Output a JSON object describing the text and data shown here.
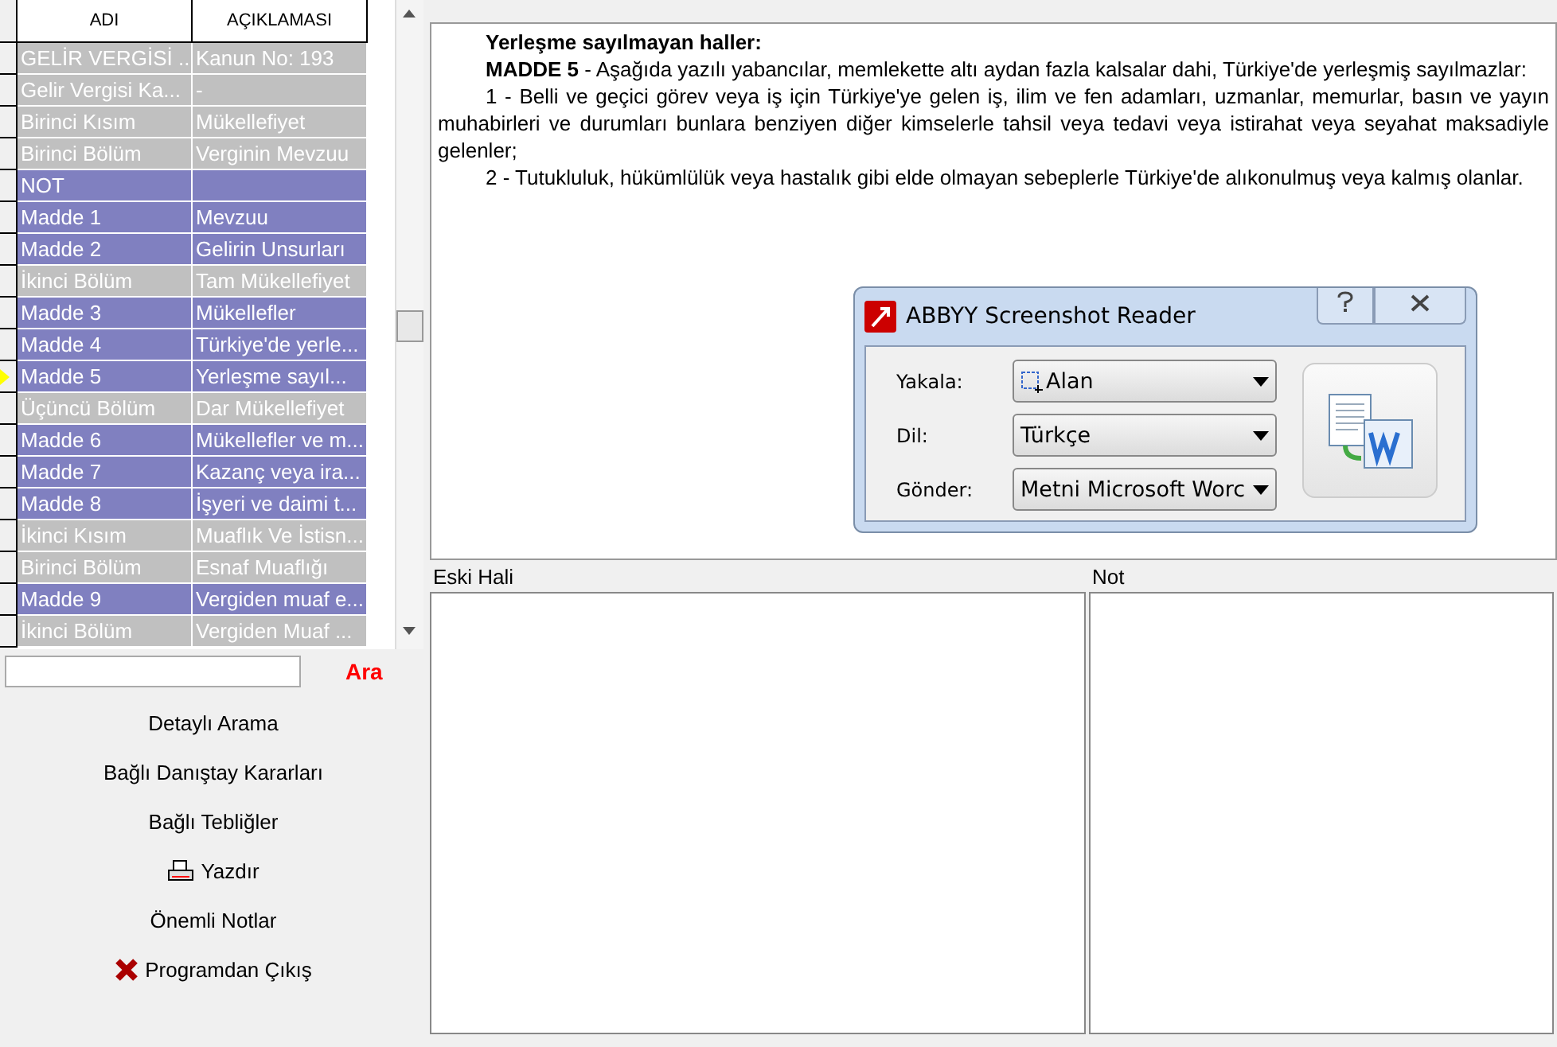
{
  "grid": {
    "columns": [
      "ADI",
      "AÇIKLAMASI"
    ],
    "rows": [
      {
        "name": "GELİR VERGİSİ ...",
        "desc": "Kanun No: 193",
        "kind": "section",
        "current": false
      },
      {
        "name": "Gelir Vergisi Ka...",
        "desc": "-",
        "kind": "section",
        "current": false
      },
      {
        "name": "Birinci Kısım",
        "desc": "Mükellefiyet",
        "kind": "section",
        "current": false
      },
      {
        "name": "Birinci Bölüm",
        "desc": "Verginin Mevzuu",
        "kind": "section",
        "current": false
      },
      {
        "name": "NOT",
        "desc": "",
        "kind": "article",
        "current": false
      },
      {
        "name": "Madde 1",
        "desc": "Mevzuu",
        "kind": "article",
        "current": false
      },
      {
        "name": "Madde 2",
        "desc": "Gelirin Unsurları",
        "kind": "article",
        "current": false
      },
      {
        "name": "İkinci Bölüm",
        "desc": "Tam Mükellefiyet",
        "kind": "section",
        "current": false
      },
      {
        "name": "Madde 3",
        "desc": "Mükellefler",
        "kind": "article",
        "current": false
      },
      {
        "name": "Madde 4",
        "desc": "Türkiye'de yerle...",
        "kind": "article",
        "current": false
      },
      {
        "name": "Madde 5",
        "desc": "Yerleşme sayıl...",
        "kind": "article",
        "current": true
      },
      {
        "name": "Üçüncü Bölüm",
        "desc": "Dar Mükellefiyet",
        "kind": "section",
        "current": false
      },
      {
        "name": "Madde 6",
        "desc": "Mükellefler ve m...",
        "kind": "article",
        "current": false
      },
      {
        "name": "Madde 7",
        "desc": "Kazanç veya ira...",
        "kind": "article",
        "current": false
      },
      {
        "name": "Madde 8",
        "desc": "İşyeri ve daimi t...",
        "kind": "article",
        "current": false
      },
      {
        "name": "İkinci Kısım",
        "desc": "Muaflık Ve İstisn...",
        "kind": "section",
        "current": false
      },
      {
        "name": "Birinci Bölüm",
        "desc": "Esnaf Muaflığı",
        "kind": "section",
        "current": false
      },
      {
        "name": "Madde 9",
        "desc": "Vergiden muaf e...",
        "kind": "article",
        "current": false
      },
      {
        "name": "İkinci Bölüm",
        "desc": "Vergiden Muaf ...",
        "kind": "section",
        "current": false
      }
    ]
  },
  "search": {
    "button": "Ara"
  },
  "menu": [
    {
      "label": "Detaylı Arama"
    },
    {
      "label": "Bağlı Danıştay Kararları"
    },
    {
      "label": "Bağlı Tebliğler"
    },
    {
      "label": "Yazdır"
    },
    {
      "label": "Önemli Notlar"
    },
    {
      "label": "Programdan Çıkış"
    }
  ],
  "article": {
    "title": "Yerleşme sayılmayan haller:",
    "paragraphs": [
      "**MADDE 5** - Aşağıda yazılı yabancılar, memlekette altı aydan fazla kalsalar dahi, Türkiye'de yerleşmiş sayılmazlar:",
      "1 - Belli ve geçici görev veya iş için Türkiye'ye gelen iş, ilim ve fen adamları, uzmanlar, memurlar, basın ve yayın muhabirleri ve durumları bunlara benziyen diğer kimselerle tahsil veya tedavi veya istirahat veya seyahat maksadiyle gelenler;",
      "2 - Tutukluluk, hükümlülük veya hastalık gibi elde olmayan sebeplerle Türkiye'de alıkonulmuş veya kalmış olanlar."
    ]
  },
  "panels": [
    {
      "label": "Eski Hali"
    },
    {
      "label": "Not"
    }
  ],
  "dialog": {
    "title": "ABBYY Screenshot Reader",
    "fields": [
      {
        "label": "Yakala:",
        "value": "Alan"
      },
      {
        "label": "Dil:",
        "value": "Türkçe"
      },
      {
        "label": "Gönder:",
        "value": "Metni Microsoft Worc"
      }
    ]
  }
}
